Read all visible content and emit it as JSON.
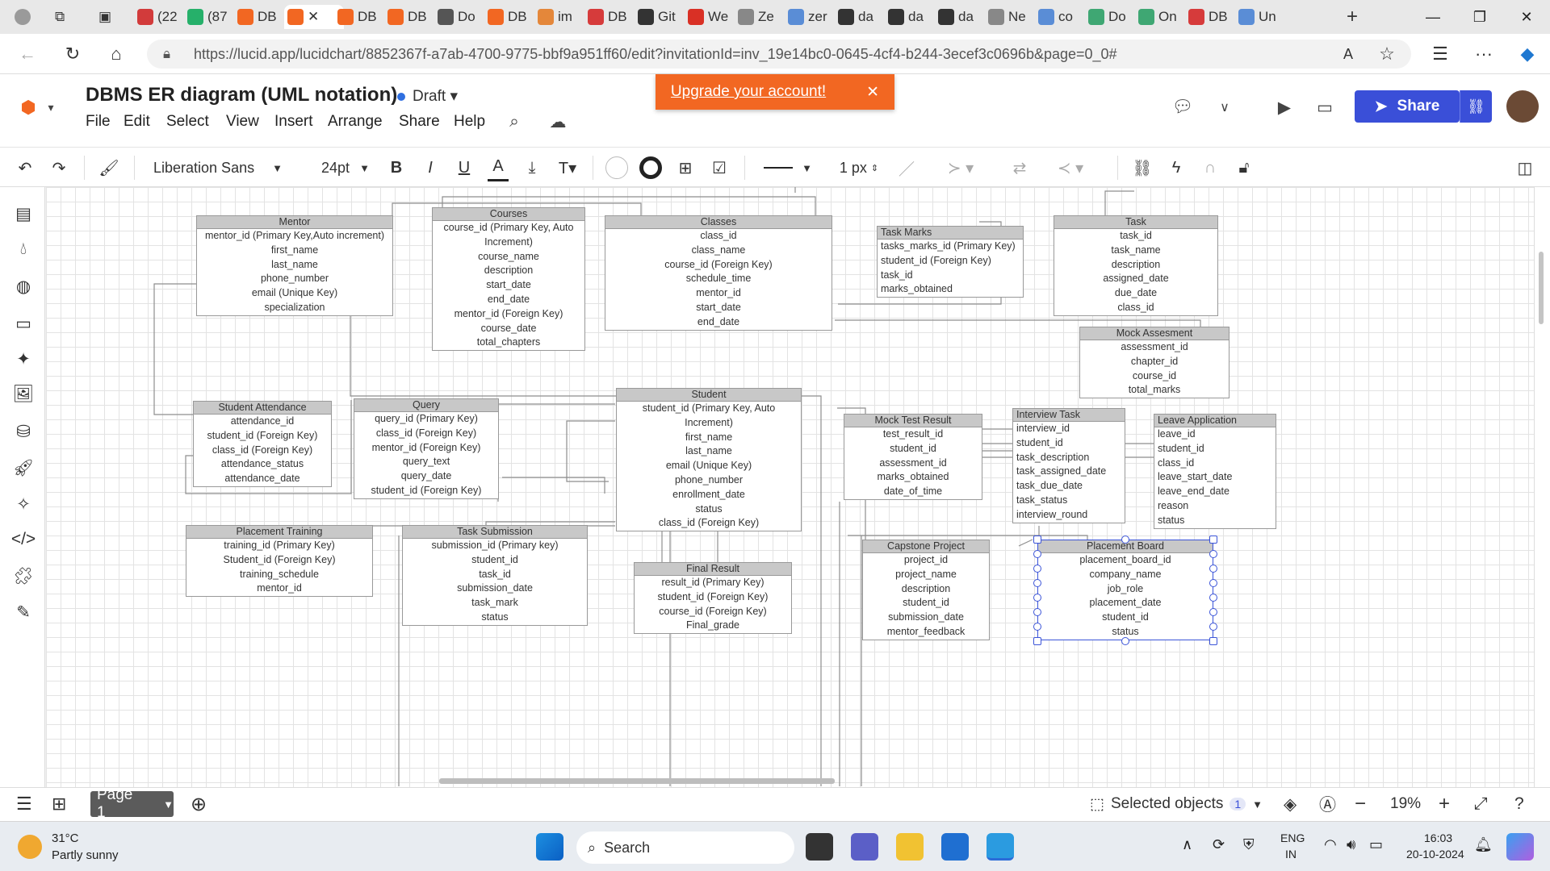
{
  "browser": {
    "tabs": [
      "(22",
      "(87",
      "DB",
      "",
      "DB",
      "DB",
      "Do",
      "DB",
      "im",
      "DB",
      "Git",
      "We",
      "Ze",
      "zer",
      "da",
      "da",
      "da",
      "Ne",
      "co",
      "Do",
      "On",
      "DB",
      "Un"
    ],
    "url": "https://lucid.app/lucidchart/8852367f-a7ab-4700-9775-bbf9a951ff60/edit?invitationId=inv_19e14bc0-0645-4cf4-b244-3ecef3c0696b&page=0_0#"
  },
  "doc": {
    "title": "DBMS ER diagram (UML notation)",
    "status": "Draft",
    "menu": [
      "File",
      "Edit",
      "Select",
      "View",
      "Insert",
      "Arrange",
      "Share",
      "Help"
    ],
    "upgrade_text": "Upgrade your account!",
    "share_label": "Share"
  },
  "toolbar": {
    "font": "Liberation Sans",
    "font_size": "24pt",
    "line_width": "1 px"
  },
  "tables": [
    {
      "id": "mentor",
      "title": "Mentor",
      "align": "c",
      "rows": [
        "mentor_id (Primary Key,Auto increment)",
        "first_name",
        "last_name",
        "phone_number",
        "email (Unique Key)",
        "specialization"
      ]
    },
    {
      "id": "courses",
      "title": "Courses",
      "align": "c",
      "rows": [
        "course_id (Primary Key, Auto",
        "Increment)",
        "course_name",
        "description",
        "start_date",
        "end_date",
        "mentor_id (Foreign Key)",
        "course_date",
        "total_chapters"
      ]
    },
    {
      "id": "classes",
      "title": "Classes",
      "align": "c",
      "rows": [
        "class_id",
        "class_name",
        "course_id (Foreign Key)",
        "schedule_time",
        "mentor_id",
        "start_date",
        "end_date"
      ]
    },
    {
      "id": "taskmarks",
      "title": "Task Marks",
      "align": "l",
      "rows": [
        "tasks_marks_id (Primary Key)",
        "student_id (Foreign Key)",
        "task_id",
        "marks_obtained"
      ]
    },
    {
      "id": "task",
      "title": "Task",
      "align": "c",
      "rows": [
        "task_id",
        "task_name",
        "description",
        "assigned_date",
        "due_date",
        "class_id"
      ]
    },
    {
      "id": "mock",
      "title": "Mock Assesment",
      "align": "c",
      "rows": [
        "assessment_id",
        "chapter_id",
        "course_id",
        "total_marks"
      ]
    },
    {
      "id": "attendance",
      "title": "Student Attendance",
      "align": "c",
      "rows": [
        "attendance_id",
        "student_id (Foreign Key)",
        "class_id (Foreign Key)",
        "attendance_status",
        "attendance_date"
      ]
    },
    {
      "id": "query",
      "title": "Query",
      "align": "c",
      "rows": [
        "query_id (Primary Key)",
        "class_id (Foreign Key)",
        "mentor_id (Foreign Key)",
        "query_text",
        "query_date",
        "student_id (Foreign Key)"
      ]
    },
    {
      "id": "student",
      "title": "Student",
      "align": "c",
      "rows": [
        "student_id (Primary Key, Auto",
        "Increment)",
        "first_name",
        "last_name",
        "email (Unique Key)",
        "phone_number",
        "enrollment_date",
        "status",
        "class_id (Foreign Key)"
      ]
    },
    {
      "id": "mockresult",
      "title": "Mock Test Result",
      "align": "c",
      "rows": [
        "test_result_id",
        "student_id",
        "assessment_id",
        "marks_obtained",
        "date_of_time"
      ]
    },
    {
      "id": "interview",
      "title": "Interview Task",
      "align": "l",
      "rows": [
        "interview_id",
        "student_id",
        "task_description",
        "task_assigned_date",
        "task_due_date",
        "task_status",
        "interview_round"
      ]
    },
    {
      "id": "leave",
      "title": "Leave Application",
      "align": "l",
      "rows": [
        "leave_id",
        "student_id",
        "class_id",
        "leave_start_date",
        "leave_end_date",
        "reason",
        "status"
      ]
    },
    {
      "id": "placement",
      "title": "Placement Training",
      "align": "c",
      "rows": [
        "training_id (Primary Key)",
        "Student_id (Foreign Key)",
        "training_schedule",
        "mentor_id"
      ]
    },
    {
      "id": "submission",
      "title": "Task Submission",
      "align": "c",
      "rows": [
        "submission_id (Primary key)",
        "student_id",
        "task_id",
        "submission_date",
        "task_mark",
        "status"
      ]
    },
    {
      "id": "final",
      "title": "Final Result",
      "align": "c",
      "rows": [
        "result_id (Primary Key)",
        "student_id (Foreign Key)",
        "course_id (Foreign Key)",
        "Final_grade"
      ]
    },
    {
      "id": "capstone",
      "title": "Capstone Project",
      "align": "c",
      "rows": [
        "project_id",
        "project_name",
        "description",
        "student_id",
        "submission_date",
        "mentor_feedback"
      ]
    },
    {
      "id": "board",
      "title": "Placement Board",
      "align": "c",
      "rows": [
        "placement_board_id",
        "company_name",
        "job_role",
        "placement_date",
        "student_id",
        "status"
      ]
    }
  ],
  "bottom": {
    "page_label": "Page 1",
    "selected_label": "Selected objects",
    "selected_count": "1",
    "zoom": "19%"
  },
  "taskbar": {
    "weather_temp": "31°C",
    "weather_desc": "Partly sunny",
    "search_label": "Search",
    "lang_top": "ENG",
    "lang_bottom": "IN",
    "time": "16:03",
    "date": "20-10-2024"
  }
}
